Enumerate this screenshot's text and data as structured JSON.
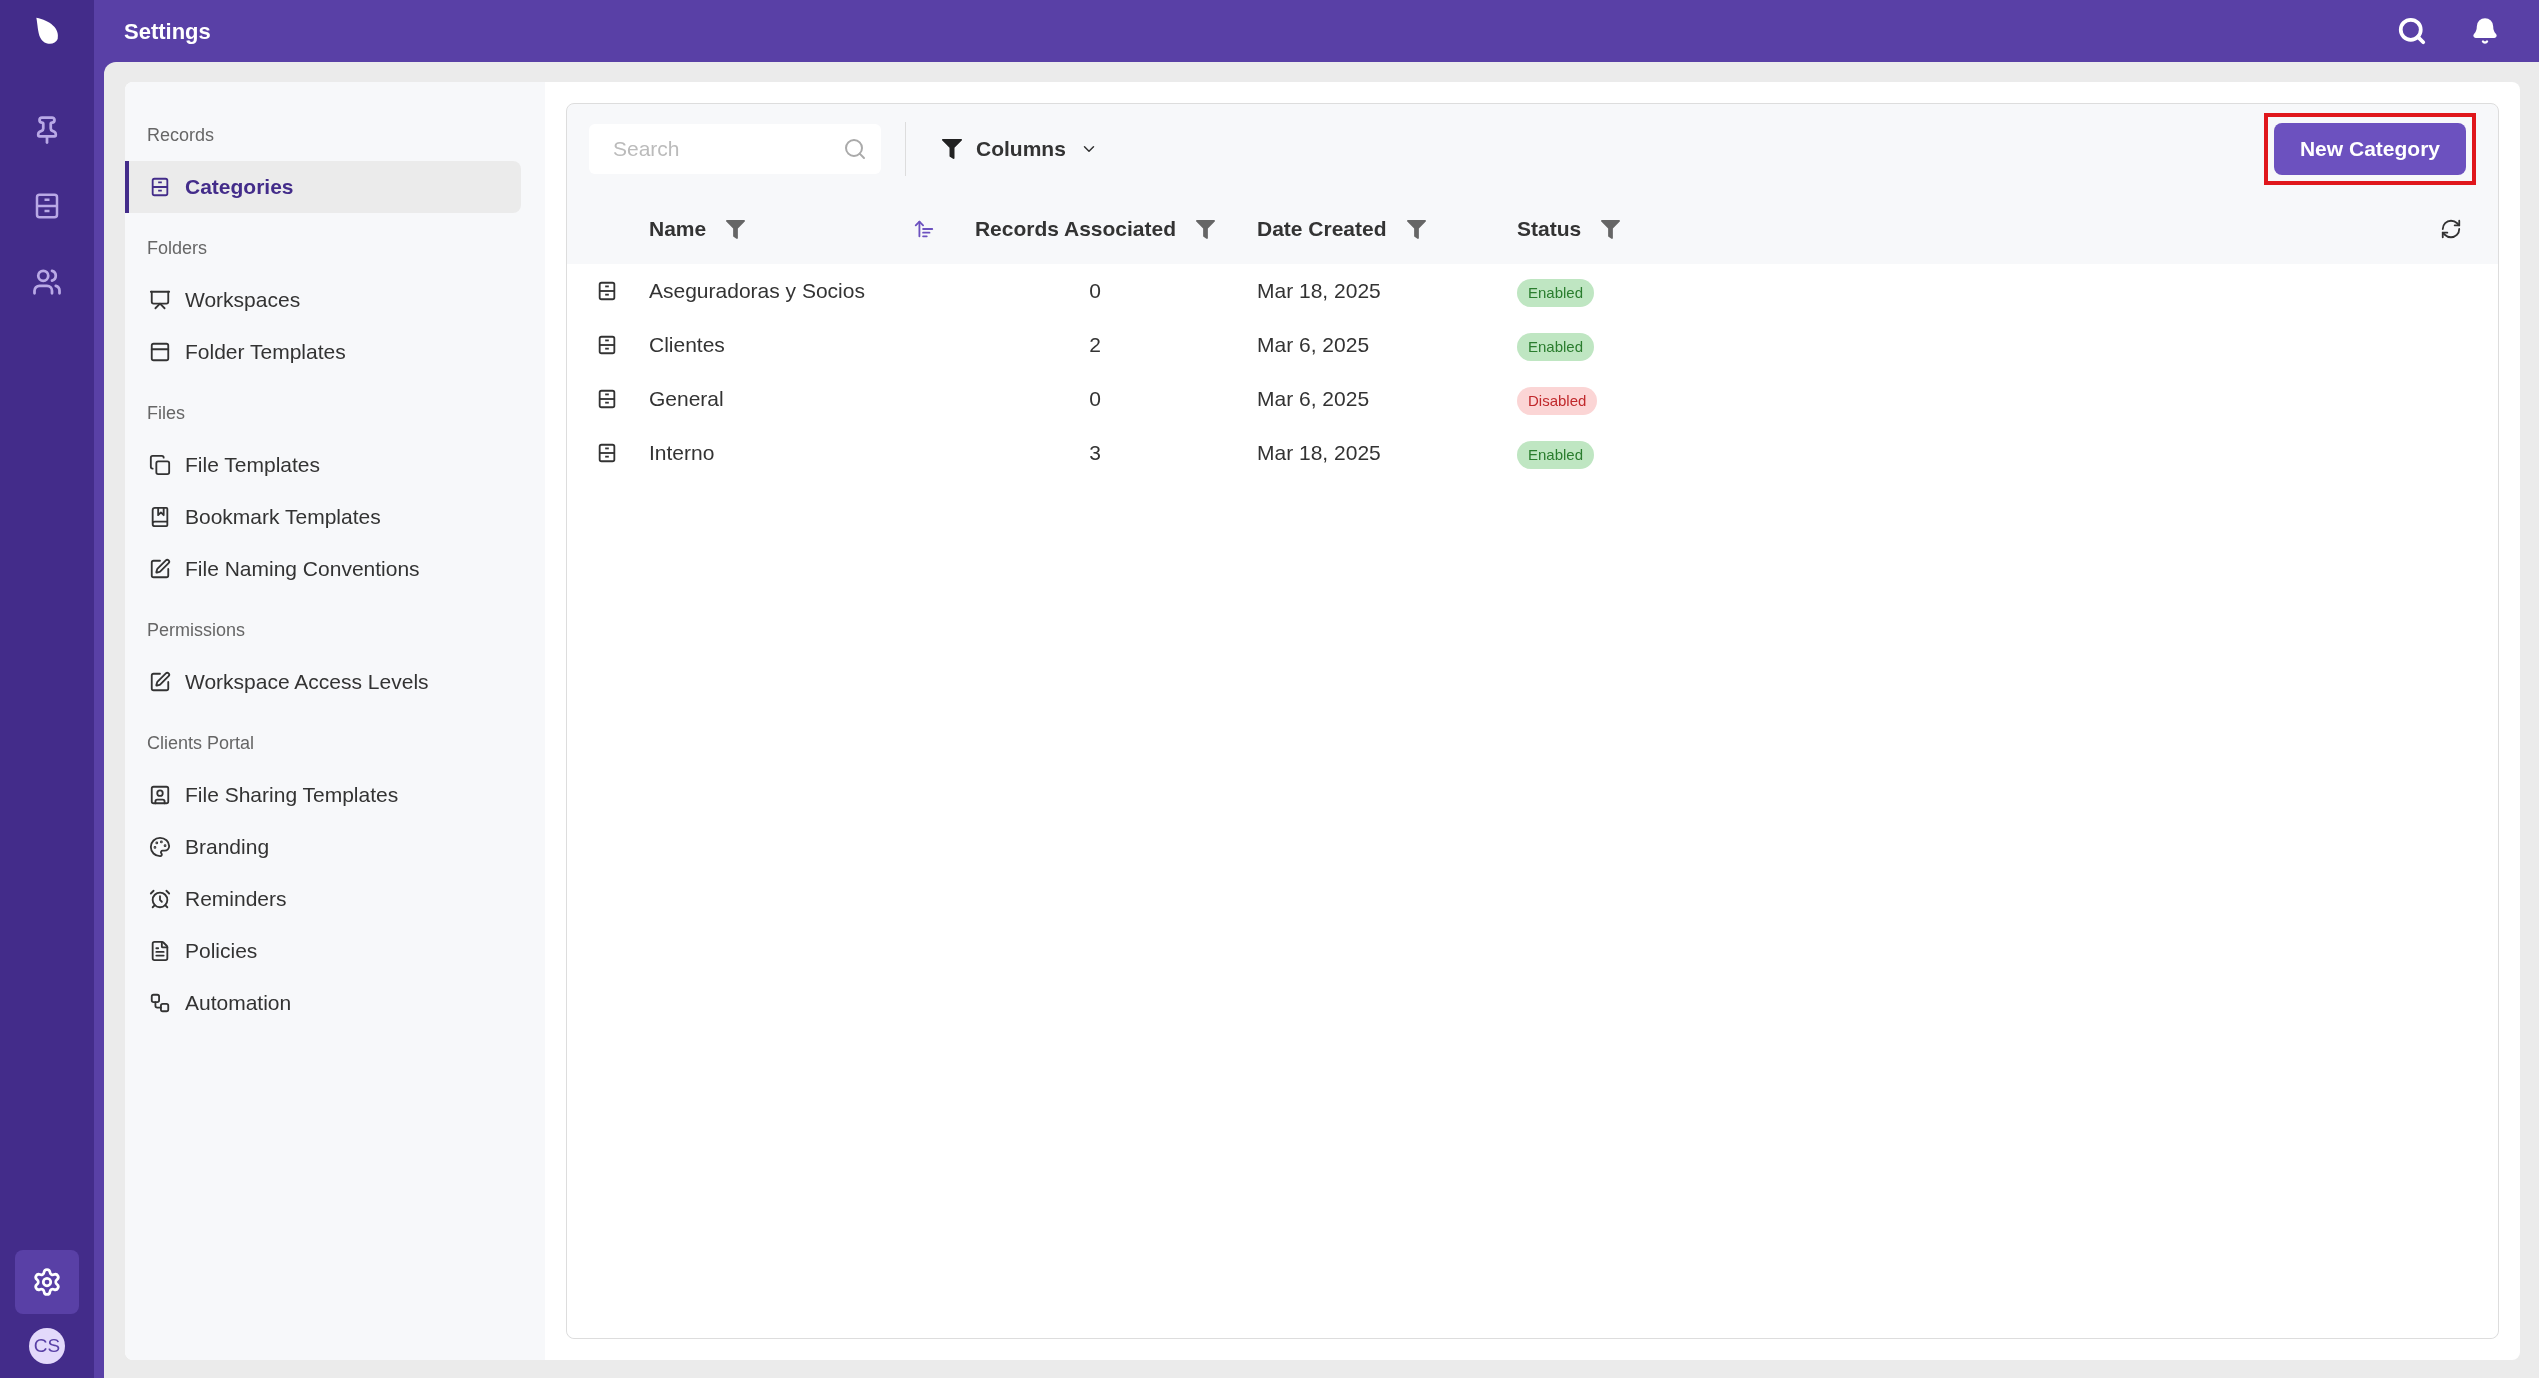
{
  "topbar": {
    "title": "Settings"
  },
  "rail": {
    "items": [
      {
        "kind": "pin",
        "selected": false
      },
      {
        "kind": "cabinet",
        "selected": false
      },
      {
        "kind": "people",
        "selected": false
      }
    ],
    "bottom": [
      {
        "kind": "settings",
        "selected": true
      }
    ],
    "avatar": "CS"
  },
  "sidebar": {
    "sections": [
      {
        "heading": "Records",
        "items": [
          {
            "label": "Categories",
            "kind": "cabinet",
            "selected": true
          }
        ]
      },
      {
        "heading": "Folders",
        "items": [
          {
            "label": "Workspaces",
            "kind": "board",
            "selected": false
          },
          {
            "label": "Folder Templates",
            "kind": "window",
            "selected": false
          }
        ]
      },
      {
        "heading": "Files",
        "items": [
          {
            "label": "File Templates",
            "kind": "copy",
            "selected": false
          },
          {
            "label": "Bookmark Templates",
            "kind": "book",
            "selected": false
          },
          {
            "label": "File Naming Conventions",
            "kind": "edit",
            "selected": false
          }
        ]
      },
      {
        "heading": "Permissions",
        "items": [
          {
            "label": "Workspace Access Levels",
            "kind": "edit",
            "selected": false
          }
        ]
      },
      {
        "heading": "Clients Portal",
        "items": [
          {
            "label": "File Sharing Templates",
            "kind": "contact",
            "selected": false
          },
          {
            "label": "Branding",
            "kind": "palette",
            "selected": false
          },
          {
            "label": "Reminders",
            "kind": "alarm",
            "selected": false
          },
          {
            "label": "Policies",
            "kind": "signature",
            "selected": false
          },
          {
            "label": "Automation",
            "kind": "workflow",
            "selected": false
          }
        ]
      }
    ]
  },
  "toolbar": {
    "search": {
      "placeholder": "Search"
    },
    "columns_button": "Columns",
    "new_button": {
      "label": "New Category",
      "highlighted": true
    }
  },
  "table": {
    "columns": [
      {
        "label": "Name",
        "sorted": true
      },
      {
        "label": "Records Associated",
        "sorted": false
      },
      {
        "label": "Date Created",
        "sorted": false
      },
      {
        "label": "Status",
        "sorted": false
      }
    ],
    "rows": [
      {
        "name": "Aseguradoras y Socios",
        "records": "0",
        "date": "Mar 18, 2025",
        "status": {
          "label": "Enabled",
          "enabled": true
        }
      },
      {
        "name": "Clientes",
        "records": "2",
        "date": "Mar 6, 2025",
        "status": {
          "label": "Enabled",
          "enabled": true
        }
      },
      {
        "name": "General",
        "records": "0",
        "date": "Mar 6, 2025",
        "status": {
          "label": "Disabled",
          "enabled": false
        }
      },
      {
        "name": "Interno",
        "records": "3",
        "date": "Mar 18, 2025",
        "status": {
          "label": "Enabled",
          "enabled": true
        }
      }
    ]
  }
}
